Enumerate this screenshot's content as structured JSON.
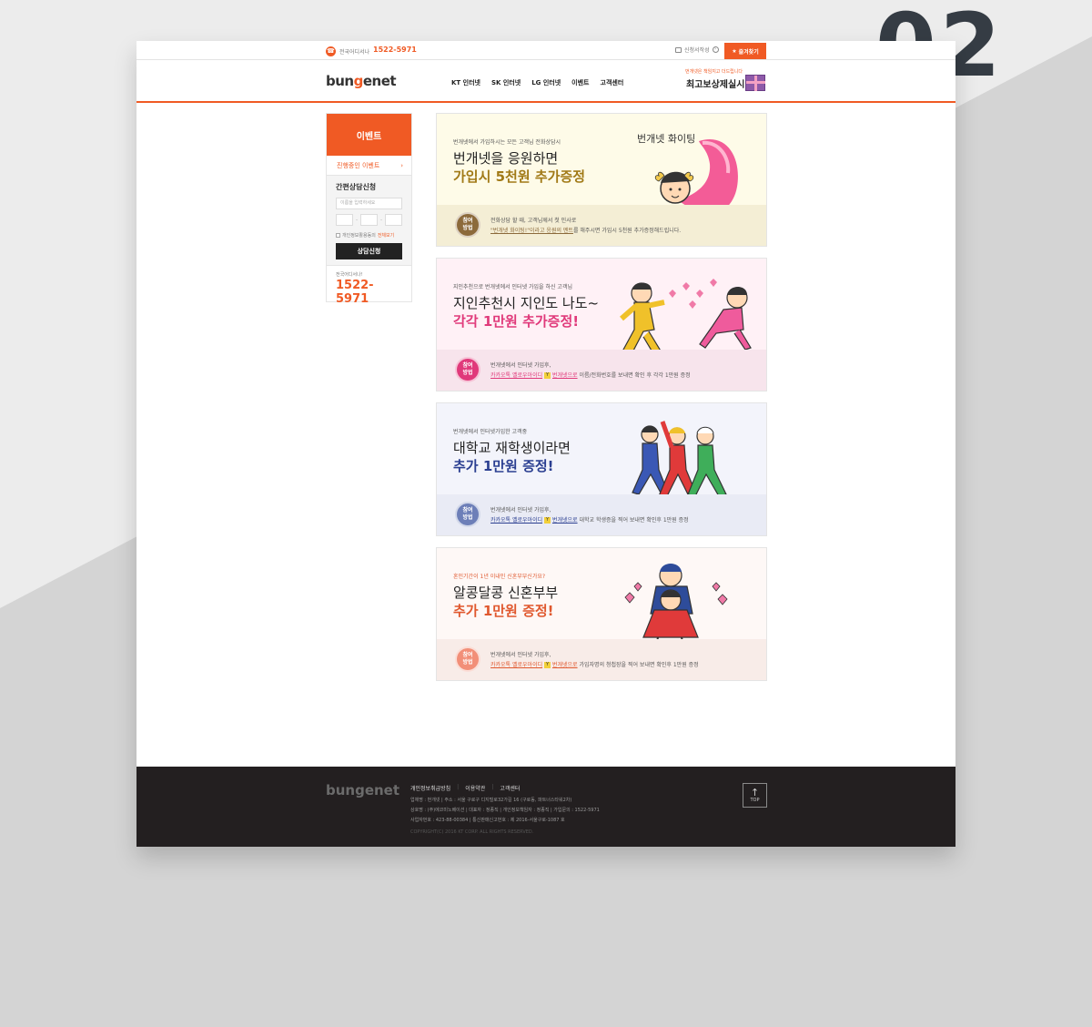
{
  "page_number": "02",
  "colors": {
    "accent": "#f05a24",
    "dark": "#231f20"
  },
  "topbar": {
    "phone_label": "전국어디서나",
    "phone_number": "1522-5971",
    "status_link": "신청서작성",
    "favorites_label": "즐겨찾기"
  },
  "header": {
    "logo_pre": "bun",
    "logo_g": "g",
    "logo_post": "enet",
    "nav": [
      "KT 인터넷",
      "SK 인터넷",
      "LG 인터넷",
      "이벤트",
      "고객센터"
    ],
    "promo_sub": "번개넷은 책임지고 더드립니다",
    "promo_main": "최고보상제실시"
  },
  "sidebar": {
    "title": "이벤트",
    "menu_item": "진행중인 이벤트",
    "consult_title": "간편상담신청",
    "name_placeholder": "이름을 입력하세요",
    "agree_text": "개인정보활용동의",
    "agree_link": "전체보기",
    "submit_label": "상담신청",
    "call_label": "전국어디서나!",
    "call_number": "1522-5971"
  },
  "events": [
    {
      "sub": "번개넷에서 가입하시는 모든 고객님 전화상담시",
      "title1": "번개넷을 응원하면",
      "title2": "가입시 5천원 추가증정",
      "badge": "참여\n방법",
      "desc1": "전화상담 할 때, 고객님께서 첫 인사로",
      "desc2_hl": "\"번개넷 화이팅!\"이라고 응원의 멘트",
      "desc2_rest": "를 해주시면 가입시 5천원 추가증정해드립니다.",
      "art_text": "번개넷 화이팅"
    },
    {
      "sub": "지인추천으로 번개넷에서 인터넷 가입을 하신 고객님",
      "title1": "지인추천시 지인도 나도~",
      "title2": "각각 1만원 추가증정!",
      "badge": "참여\n방법",
      "desc1": "번개넷에서 인터넷 가입후,",
      "desc2_hl": "카카오톡 옐로우아이디",
      "desc2_y": "Y",
      "desc2_hl2": "번개넷으로",
      "desc2_rest": "이름/전화번호를 보내면 확인 후 각각 1만원 증정"
    },
    {
      "sub": "번개넷에서 인터넷가입한 고객중",
      "title1": "대학교 재학생이라면",
      "title2": "추가 1만원 증정!",
      "badge": "참여\n방법",
      "desc1": "번개넷에서 인터넷 가입후,",
      "desc2_hl": "카카오톡 옐로우아이디",
      "desc2_y": "Y",
      "desc2_hl2": "번개넷으로",
      "desc2_rest": "대학교 학생증을 찍어 보내면 확인후 1만원 증정"
    },
    {
      "sub": "혼인기간이 1년 이내인 신혼부부신가요?",
      "title1": "알콩달콩 신혼부부",
      "title2": "추가 1만원 증정!",
      "badge": "참여\n방법",
      "desc1": "번개넷에서 인터넷 가입후,",
      "desc2_hl": "카카오톡 옐로우아이디",
      "desc2_y": "Y",
      "desc2_hl2": "번개넷으로",
      "desc2_rest": "가입자명의 청첩장을 찍어 보내면 확인후 1만원 증정"
    }
  ],
  "footer": {
    "logo": "bungenet",
    "links": [
      "개인정보취급방침",
      "이용약관",
      "고객센터"
    ],
    "line1": "업체명 : 번개넷 | 주소 : 서울 구로구 디지털로32가길 16 (구로동, 파트너스타워2차)",
    "line2": "상호명 : (주)에코미노베이션 | 대표자 : 정종직 | 개인정보책임자 : 정종직 | 가입문의 : 1522-5971",
    "line3": "사업자번호 : 423-88-00384 | 통신판매신고번호 : 제 2016-서울구로-1087 호",
    "copyright": "COPYRIGHT(C) 2016 KT CORP. ALL RIGHTS RESERVED.",
    "top_label": "TOP"
  }
}
